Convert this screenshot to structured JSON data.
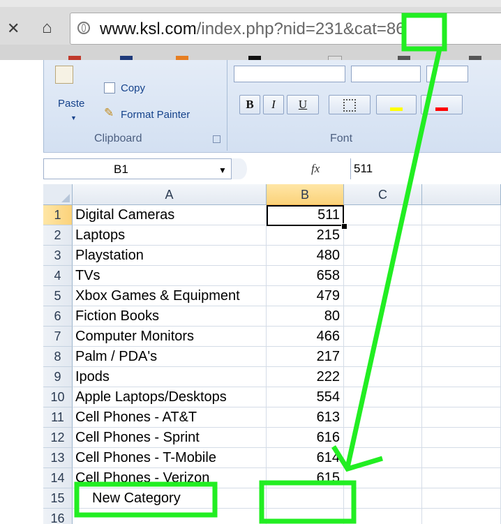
{
  "browser": {
    "url_domain": "www.ksl.com",
    "url_path": "/index.php?nid=231&cat=86"
  },
  "ribbon": {
    "copy_label": "Copy",
    "paste_label": "Paste",
    "format_painter_label": "Format Painter",
    "clipboard_group_label": "Clipboard",
    "font_group_label": "Font",
    "bold_label": "B",
    "italic_label": "I",
    "underline_label": "U"
  },
  "formula_bar": {
    "name_box": "B1",
    "fx_label": "fx",
    "value": "511"
  },
  "sheet": {
    "columns": [
      "A",
      "B",
      "C"
    ],
    "selected_column": "B",
    "selected_row": "1",
    "rows": [
      {
        "num": "1",
        "a": "Digital Cameras",
        "b": "511"
      },
      {
        "num": "2",
        "a": "Laptops",
        "b": "215"
      },
      {
        "num": "3",
        "a": "Playstation",
        "b": "480"
      },
      {
        "num": "4",
        "a": "TVs",
        "b": "658"
      },
      {
        "num": "5",
        "a": "Xbox Games & Equipment",
        "b": "479"
      },
      {
        "num": "6",
        "a": "Fiction Books",
        "b": "80"
      },
      {
        "num": "7",
        "a": "Computer Monitors",
        "b": "466"
      },
      {
        "num": "8",
        "a": "Palm / PDA's",
        "b": "217"
      },
      {
        "num": "9",
        "a": "Ipods",
        "b": "222"
      },
      {
        "num": "10",
        "a": "Apple Laptops/Desktops",
        "b": "554"
      },
      {
        "num": "11",
        "a": "Cell Phones - AT&T",
        "b": "613"
      },
      {
        "num": "12",
        "a": "Cell Phones - Sprint",
        "b": "616"
      },
      {
        "num": "13",
        "a": "Cell Phones - T-Mobile",
        "b": "614"
      },
      {
        "num": "14",
        "a": "Cell Phones - Verizon",
        "b": "615"
      },
      {
        "num": "15",
        "a": "New Category",
        "b": ""
      },
      {
        "num": "16",
        "a": "",
        "b": ""
      }
    ]
  },
  "annotation": {
    "color": "#22ee22"
  }
}
